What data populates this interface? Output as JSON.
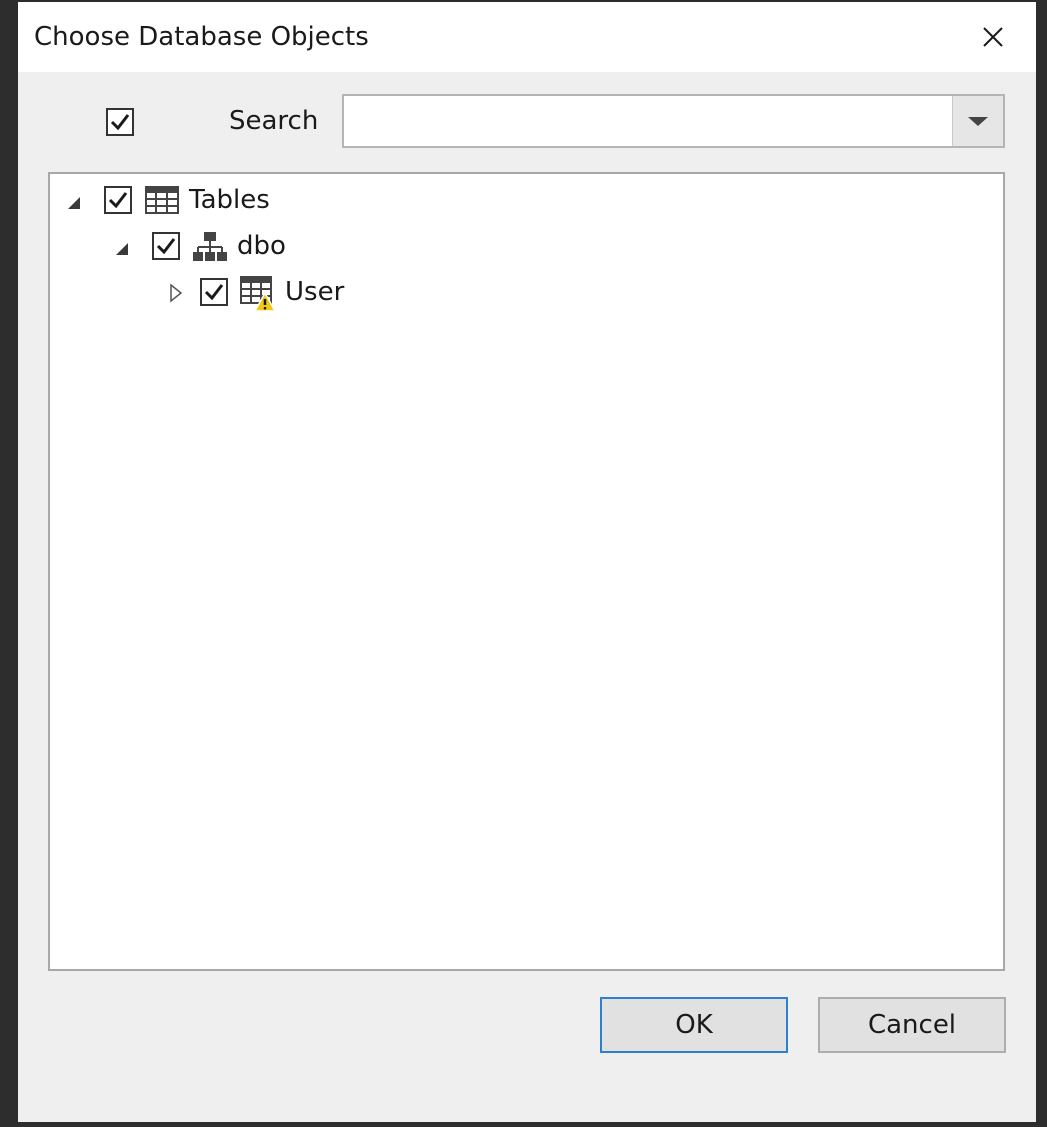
{
  "dialog": {
    "title": "Choose Database Objects",
    "close_icon": "close-icon"
  },
  "search": {
    "select_all_checked": true,
    "label": "Search",
    "value": "",
    "dropdown_icon": "chevron-down-icon"
  },
  "tree": {
    "nodes": [
      {
        "label": "Tables",
        "checked": true,
        "expanded": true,
        "icon": "table-icon"
      },
      {
        "label": "dbo",
        "checked": true,
        "expanded": true,
        "icon": "schema-hierarchy-icon"
      },
      {
        "label": "User",
        "checked": true,
        "expanded": false,
        "icon": "table-warning-icon"
      }
    ]
  },
  "buttons": {
    "ok_label": "OK",
    "cancel_label": "Cancel"
  },
  "colors": {
    "accent": "#2f7fcf",
    "dialog_bg": "#efefef",
    "warning": "#f2c811"
  }
}
